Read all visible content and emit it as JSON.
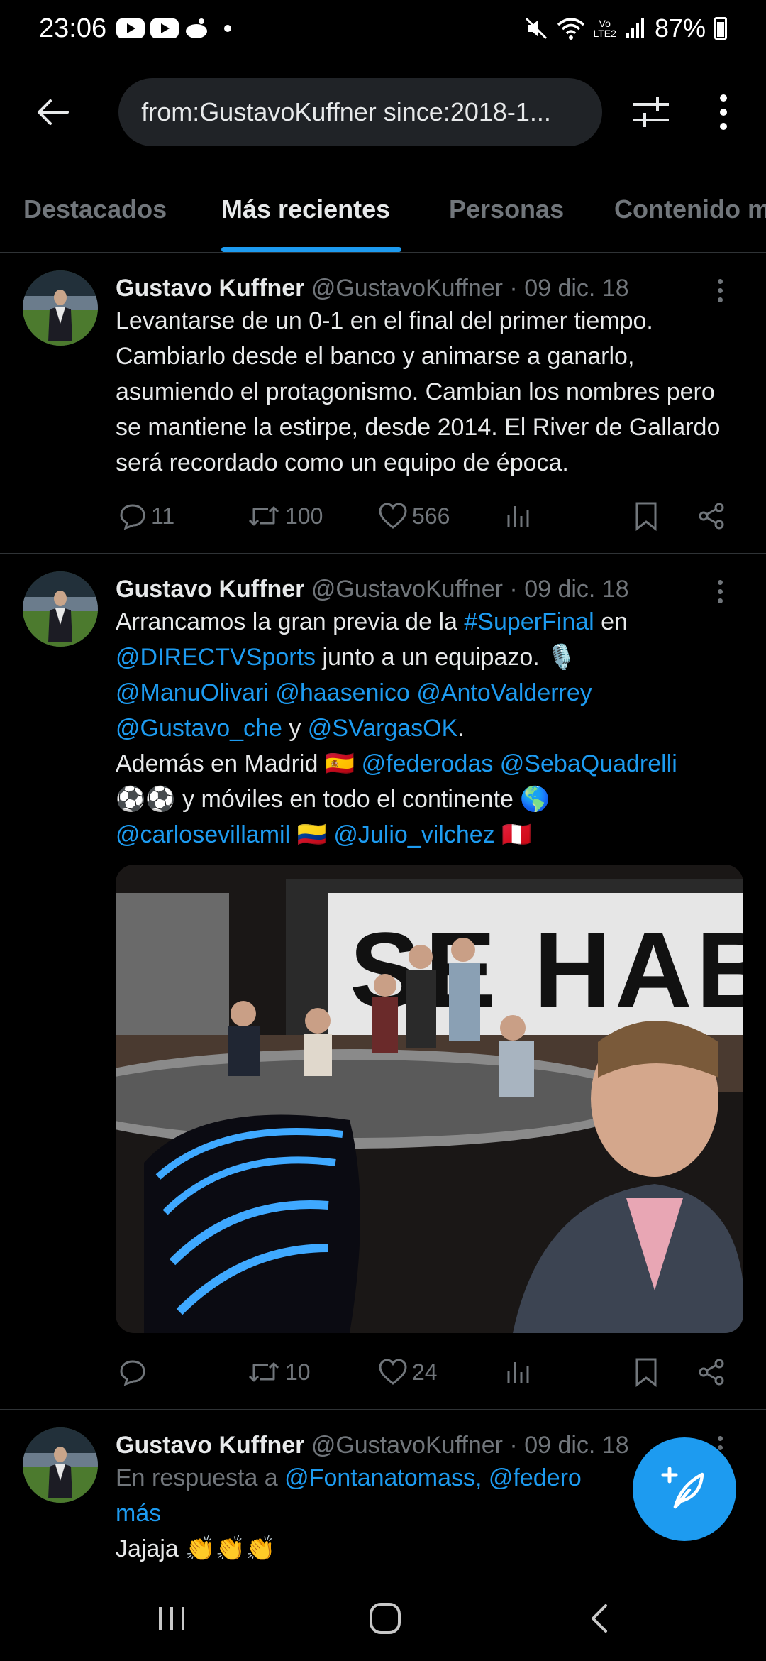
{
  "status_bar": {
    "time": "23:06",
    "volte_line1": "Vo",
    "volte_line2": "LTE2",
    "battery": "87%"
  },
  "search": {
    "query": "from:GustavoKuffner since:2018-1..."
  },
  "tabs": [
    {
      "label": "Destacados"
    },
    {
      "label": "Más recientes"
    },
    {
      "label": "Personas"
    },
    {
      "label": "Contenido m"
    }
  ],
  "tweets": [
    {
      "name": "Gustavo Kuffner",
      "handle": "@GustavoKuffner",
      "sep": "·",
      "date": "09 dic. 18",
      "text": "Levantarse de un 0-1 en el final del primer tiempo. Cambiarlo desde el banco y animarse a ganarlo, asumiendo el protagonismo. Cambian los nombres pero se mantiene la estirpe, desde 2014. El River de Gallardo será recordado como un equipo de época.",
      "replies": "11",
      "retweets": "100",
      "likes": "566"
    },
    {
      "name": "Gustavo Kuffner",
      "handle": "@GustavoKuffner",
      "sep": "·",
      "date": "09 dic. 18",
      "t1": "Arrancamos la gran previa de la ",
      "tag_superfinal": "#SuperFinal",
      "t2": " en",
      "m_directv": "@DIRECTVSports",
      "t3": " junto a un equipazo. 🎙️",
      "m_manu": "@ManuOlivari",
      "m_haase": "@haasenico",
      "m_anto": "@AntoValderrey",
      "m_gustavo": "@Gustavo_che",
      "t4": " y ",
      "m_svargas": "@SVargasOK",
      "t5": ".",
      "t6": "Además en Madrid 🇪🇸 ",
      "m_federodas": "@federodas",
      "m_seba": "@SebaQuadrelli",
      "t7": "⚽⚽ y móviles en todo el continente 🌎",
      "m_carlos": "@carlosevillamil",
      "t8": " 🇨🇴 ",
      "m_julio": "@Julio_vilchez",
      "t9": " 🇵🇪",
      "media_sign": "SE HABLA",
      "replies": "",
      "retweets": "10",
      "likes": "24"
    },
    {
      "name": "Gustavo Kuffner",
      "handle": "@GustavoKuffner",
      "sep": "·",
      "date": "09 dic. 18",
      "reply_prefix": "En respuesta a ",
      "reply_to": "@Fontanatomass, @federo",
      "reply_more": "más",
      "text": "Jajaja 👏👏👏"
    }
  ],
  "colors": {
    "accent": "#1d9bf0",
    "background": "#000000",
    "muted": "#71767b",
    "divider": "#2f3336"
  }
}
